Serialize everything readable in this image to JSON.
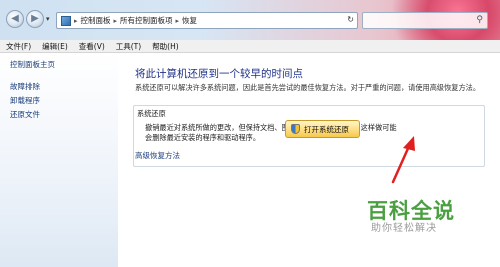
{
  "address": {
    "crumbs": [
      "控制面板",
      "所有控制面板项",
      "恢复"
    ]
  },
  "menu": {
    "items": [
      "文件(F)",
      "编辑(E)",
      "查看(V)",
      "工具(T)",
      "帮助(H)"
    ]
  },
  "sidebar": {
    "home": "控制面板主页",
    "items": [
      "故障排除",
      "卸载程序",
      "还原文件"
    ]
  },
  "main": {
    "title": "将此计算机还原到一个较早的时间点",
    "description": "系统还原可以解决许多系统问题，因此是首先尝试的最佳恢复方法。对于严重的问题，请使用高级恢复方法。",
    "group_title": "系统还原",
    "group_text_line1": "撤销最近对系统所做的更改，但保持文档、图片和音乐等文件不变。这样做可能",
    "group_text_line2": "会删除最近安装的程序和驱动程序。",
    "open_restore_label": "打开系统还原",
    "advanced_link": "高级恢复方法"
  },
  "watermark": {
    "main": "百科全说",
    "sub": "助你轻松解决"
  },
  "colors": {
    "annotation_arrow": "#e02020",
    "watermark_green": "#4aa041"
  }
}
